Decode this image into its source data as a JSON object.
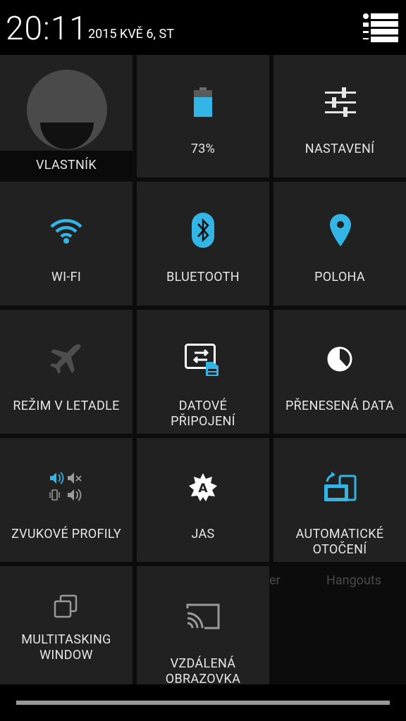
{
  "status": {
    "time": "20:11",
    "date": "2015 KVĚ 6, ST"
  },
  "tiles": {
    "owner": "VLASTNÍK",
    "battery": "73%",
    "settings": "NASTAVENÍ",
    "wifi": "WI-FI",
    "bluetooth": "BLUETOOTH",
    "location": "POLOHA",
    "airplane": "REŽIM V LETADLE",
    "data_line1": "DATOVÉ",
    "data_line2": "PŘIPOJENÍ",
    "data_usage": "PŘENESENÁ DATA",
    "sound_profiles": "ZVUKOVÉ PROFILY",
    "brightness": "JAS",
    "rotate_line1": "AUTOMATICKÉ",
    "rotate_line2": "OTOČENÍ",
    "multitask_line1": "MULTITASKING",
    "multitask_line2": "WINDOW",
    "cast_line1": "VZDÁLENÁ",
    "cast_line2": "OBRAZOVKA"
  },
  "background": {
    "ghost_left": "er",
    "ghost_right": "Hangouts"
  },
  "colors": {
    "accent": "#33b5e5",
    "tile": "#212121"
  }
}
